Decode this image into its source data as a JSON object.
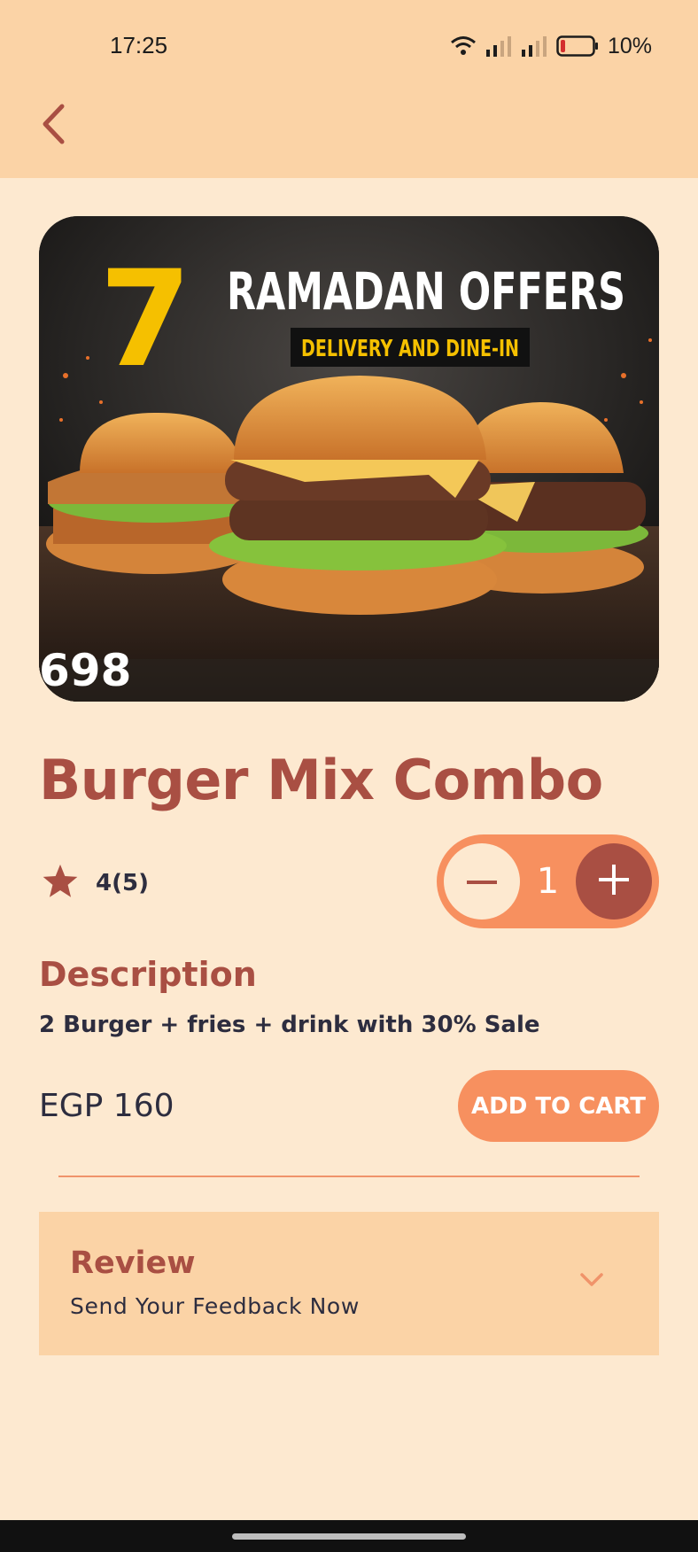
{
  "status_bar": {
    "time": "17:25",
    "battery": "10%",
    "icons": [
      "wifi-icon",
      "signal-icon",
      "signal-icon",
      "battery-icon"
    ]
  },
  "header": {
    "back_icon": "chevron-left-icon"
  },
  "hero_image": {
    "big_number": "7",
    "headline": "RAMADAN OFFERS",
    "tagline": "DELIVERY AND DINE-IN",
    "corner_text": "698"
  },
  "product": {
    "name": "Burger Mix Combo",
    "rating": "4(5)",
    "quantity": "1",
    "description_heading": "Description",
    "description": "2 Burger + fries + drink with 30% Sale",
    "price": "EGP 160",
    "add_to_cart_label": "ADD TO CART"
  },
  "review": {
    "title": "Review",
    "subtitle": "Send Your Feedback Now"
  },
  "colors": {
    "header_bg": "#fbd3a6",
    "page_bg": "#fde9d0",
    "accent": "#a94f43",
    "orange": "#f7905f",
    "text_dark": "#2d2d3f"
  }
}
